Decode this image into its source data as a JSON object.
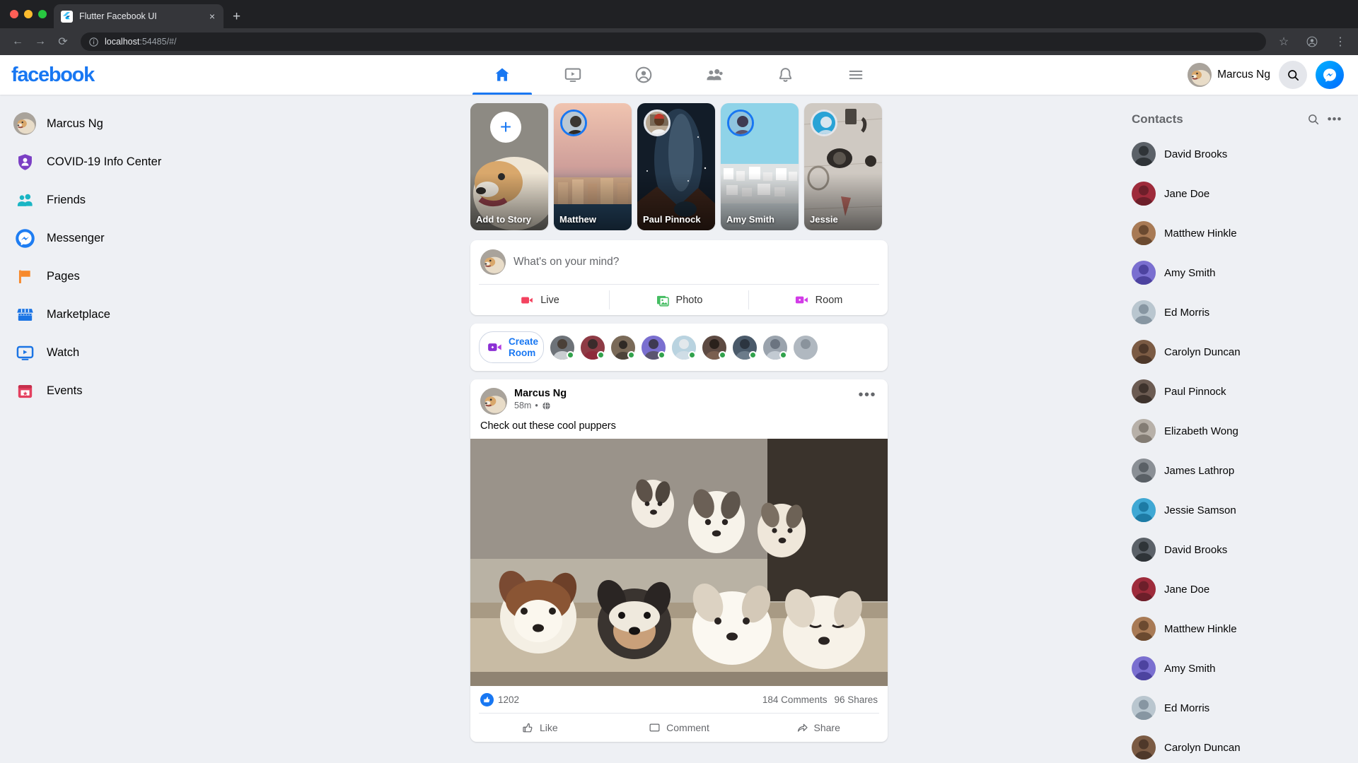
{
  "browser": {
    "tab_title": "Flutter Facebook UI",
    "tab_close": "×",
    "new_tab": "+",
    "back": "←",
    "forward": "→",
    "reload": "⟳",
    "url_host": "localhost",
    "url_rest": ":54485/#/",
    "star": "☆",
    "menu": "⋮"
  },
  "header": {
    "logo": "facebook",
    "nav": [
      {
        "name": "home",
        "active": true
      },
      {
        "name": "watch",
        "active": false
      },
      {
        "name": "profile",
        "active": false
      },
      {
        "name": "groups",
        "active": false
      },
      {
        "name": "notifications",
        "active": false
      },
      {
        "name": "menu",
        "active": false
      }
    ],
    "user_name": "Marcus Ng",
    "search_label": "search-icon",
    "messenger_label": "messenger-icon",
    "accent": "#1877f2"
  },
  "sidebar": {
    "items": [
      {
        "label": "Marcus Ng",
        "icon": "avatar"
      },
      {
        "label": "COVID-19 Info Center",
        "icon": "shield-person",
        "color": "#7b3fc4"
      },
      {
        "label": "Friends",
        "icon": "people",
        "color": "#1ab5c4"
      },
      {
        "label": "Messenger",
        "icon": "messenger",
        "color": "#1e7df2"
      },
      {
        "label": "Pages",
        "icon": "flag",
        "color": "#f7892b"
      },
      {
        "label": "Marketplace",
        "icon": "store",
        "color": "#1b74e4"
      },
      {
        "label": "Watch",
        "icon": "watch",
        "color": "#1b74e4"
      },
      {
        "label": "Events",
        "icon": "calendar",
        "color": "#e4405f"
      }
    ]
  },
  "stories": [
    {
      "name": "Add to Story",
      "type": "add",
      "bg1": "#9d9a92",
      "bg2": "#d9cdb8"
    },
    {
      "name": "Matthew",
      "type": "story",
      "bg1": "#e7b7a4",
      "bg2": "#3c5a78"
    },
    {
      "name": "Paul Pinnock",
      "type": "story",
      "bg1": "#16212e",
      "bg2": "#4b2a1c"
    },
    {
      "name": "Amy Smith",
      "type": "story",
      "bg1": "#8fd3e8",
      "bg2": "#cfd8dc"
    },
    {
      "name": "Jessie",
      "type": "story",
      "bg1": "#cfc9c2",
      "bg2": "#b5ada4"
    }
  ],
  "composer": {
    "placeholder": "What's on your mind?",
    "actions": [
      {
        "label": "Live",
        "icon": "video-camera-icon",
        "color": "#f3425f"
      },
      {
        "label": "Photo",
        "icon": "photo-icon",
        "color": "#45bd62"
      },
      {
        "label": "Room",
        "icon": "room-icon",
        "color": "#d23be7"
      }
    ]
  },
  "rooms": {
    "create_label_line1": "Create",
    "create_label_line2": "Room",
    "contacts_colors": [
      "#6d7278",
      "#8e3b45",
      "#7a6a58",
      "#7a6fd0",
      "#a8cfe0",
      "#5d4a42",
      "#4a5a6a",
      "#9aa3ad",
      "#b0b8c0"
    ]
  },
  "post": {
    "author": "Marcus Ng",
    "time": "58m",
    "dot": "•",
    "privacy_icon": "globe-icon",
    "more_icon": "•••",
    "text": "Check out these cool puppers",
    "likes": "1202",
    "comments": "184 Comments",
    "shares": "96 Shares",
    "actions": [
      {
        "label": "Like",
        "icon": "thumbs-up-icon"
      },
      {
        "label": "Comment",
        "icon": "comment-icon"
      },
      {
        "label": "Share",
        "icon": "share-icon"
      }
    ]
  },
  "contacts": {
    "title": "Contacts",
    "search_icon": "search-icon",
    "more_icon": "•••",
    "items": [
      {
        "name": "David Brooks",
        "c1": "#5b6168",
        "c2": "#2f3438"
      },
      {
        "name": "Jane Doe",
        "c1": "#9e2b3b",
        "c2": "#6d1f2a"
      },
      {
        "name": "Matthew Hinkle",
        "c1": "#a87a55",
        "c2": "#6b4a30"
      },
      {
        "name": "Amy Smith",
        "c1": "#7a6fd0",
        "c2": "#4d43a0"
      },
      {
        "name": "Ed Morris",
        "c1": "#b9c6cf",
        "c2": "#8796a2"
      },
      {
        "name": "Carolyn Duncan",
        "c1": "#7b5b44",
        "c2": "#4e382a"
      },
      {
        "name": "Paul Pinnock",
        "c1": "#6b5b52",
        "c2": "#3e332d"
      },
      {
        "name": "Elizabeth Wong",
        "c1": "#b7b0a8",
        "c2": "#837c74"
      },
      {
        "name": "James Lathrop",
        "c1": "#8a8f95",
        "c2": "#5a6066"
      },
      {
        "name": "Jessie Samson",
        "c1": "#3fa8d4",
        "c2": "#1d7ba5"
      },
      {
        "name": "David Brooks",
        "c1": "#5b6168",
        "c2": "#2f3438"
      },
      {
        "name": "Jane Doe",
        "c1": "#9e2b3b",
        "c2": "#6d1f2a"
      },
      {
        "name": "Matthew Hinkle",
        "c1": "#a87a55",
        "c2": "#6b4a30"
      },
      {
        "name": "Amy Smith",
        "c1": "#7a6fd0",
        "c2": "#4d43a0"
      },
      {
        "name": "Ed Morris",
        "c1": "#b9c6cf",
        "c2": "#8796a2"
      },
      {
        "name": "Carolyn Duncan",
        "c1": "#7b5b44",
        "c2": "#4e382a"
      }
    ]
  }
}
